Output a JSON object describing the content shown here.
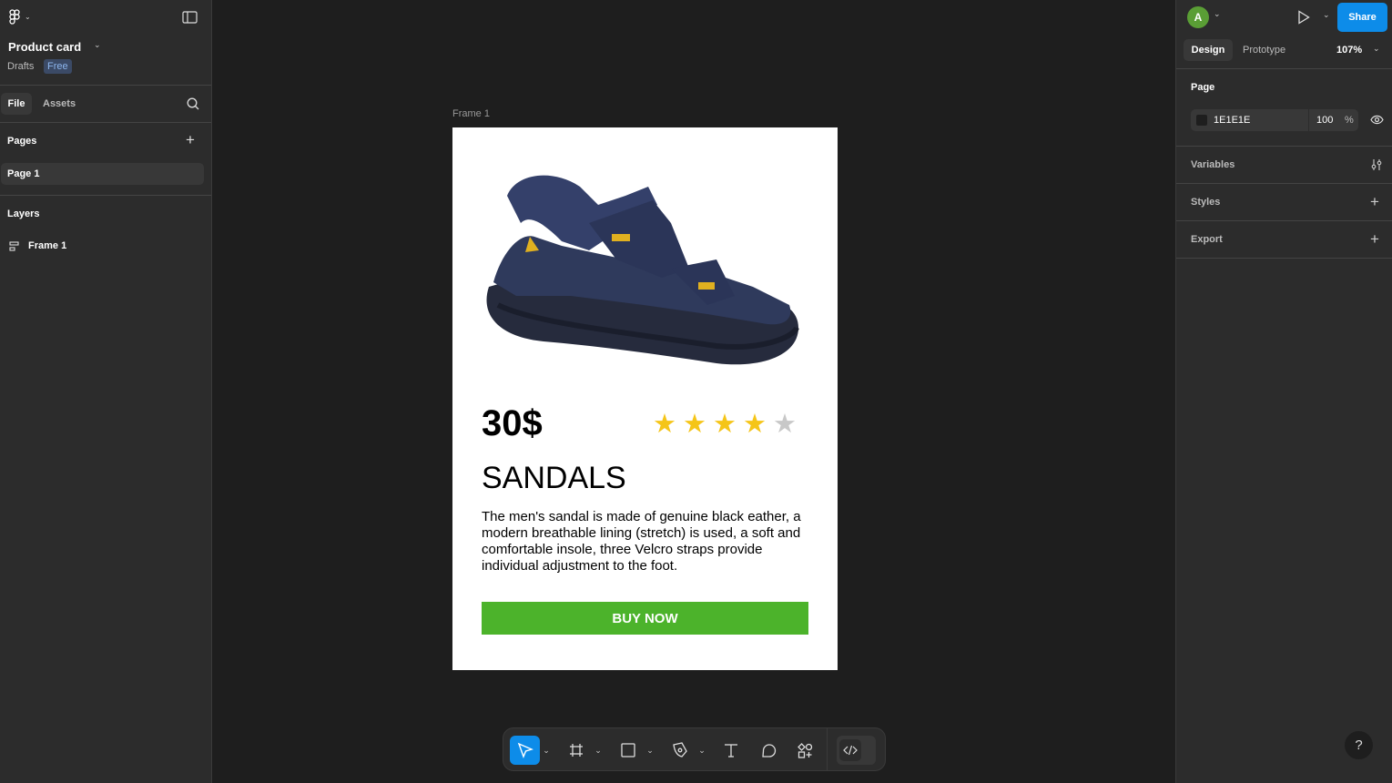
{
  "left_panel": {
    "file_title": "Product card",
    "location": "Drafts",
    "plan_badge": "Free",
    "tabs": [
      {
        "label": "File",
        "active": true
      },
      {
        "label": "Assets",
        "active": false
      }
    ],
    "pages_heading": "Pages",
    "pages": [
      {
        "label": "Page 1",
        "selected": true
      }
    ],
    "layers_heading": "Layers",
    "layers": [
      {
        "label": "Frame 1",
        "icon": "frame-layout-icon"
      }
    ]
  },
  "canvas": {
    "frame_label": "Frame 1",
    "card": {
      "price": "30$",
      "rating": 4,
      "rating_max": 5,
      "title": "SANDALS",
      "description": "The men's sandal is made of genuine black eather, a modern breathable lining (stretch) is used, a soft and comfortable insole, three Velcro straps provide individual adjustment to the foot.",
      "button_label": "BUY NOW",
      "button_color": "#4CB32B",
      "star_color": "#F5C518",
      "star_empty_color": "#C8C8C8"
    }
  },
  "right_panel": {
    "avatar_initial": "A",
    "avatar_color": "#5A9E35",
    "share_label": "Share",
    "tabs": [
      {
        "label": "Design",
        "active": true
      },
      {
        "label": "Prototype",
        "active": false
      }
    ],
    "zoom": "107%",
    "page_heading": "Page",
    "page_color": "1E1E1E",
    "page_opacity": "100",
    "percent": "%",
    "sections": [
      "Variables",
      "Styles",
      "Export"
    ]
  },
  "toolbar": {
    "tools": [
      "move-tool",
      "frame-tool",
      "rectangle-tool",
      "pen-tool",
      "text-tool",
      "comment-tool",
      "actions-tool",
      "dev-mode-toggle"
    ],
    "active_tool": "move-tool"
  },
  "help_label": "?"
}
